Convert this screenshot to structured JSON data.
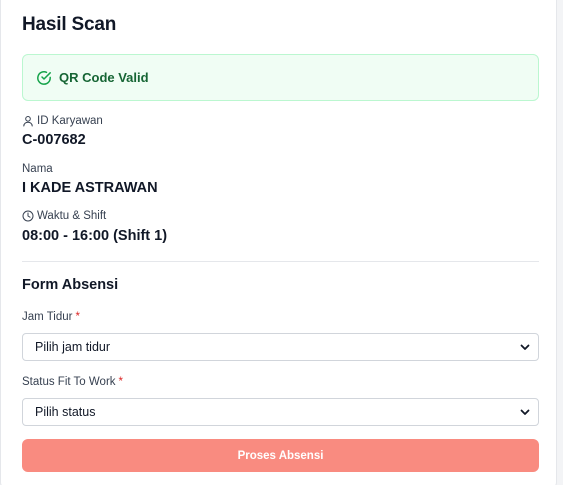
{
  "header": {
    "title": "Hasil Scan"
  },
  "alert": {
    "text": "QR Code Valid",
    "icon": "check-circle-icon",
    "color": "#166534"
  },
  "employee": {
    "id_label": "ID Karyawan",
    "id_value": "C-007682",
    "name_label": "Nama",
    "name_value": "I KADE ASTRAWAN",
    "shift_label": "Waktu & Shift",
    "shift_value": "08:00 - 16:00 (Shift 1)"
  },
  "form": {
    "title": "Form Absensi",
    "required_mark": "*",
    "sleep_label": "Jam Tidur",
    "sleep_value": "Pilih jam tidur",
    "fit_label": "Status Fit To Work",
    "fit_value": "Pilih status",
    "submit_label": "Proses Absensi",
    "submit_color": "#f98b80"
  }
}
